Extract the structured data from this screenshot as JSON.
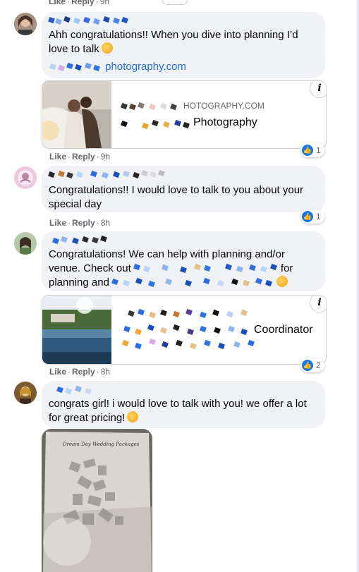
{
  "top": {
    "like": "Like",
    "reply": "Reply",
    "time": "9h"
  },
  "comments": [
    {
      "text_line1": "Ahh congratulations!! When you dive into planning I’d",
      "text_line2": "love to talk",
      "emoji_icon": "smiling-face-with-hearts",
      "link_text": "photography.com",
      "card": {
        "site": "HOTOGRAPHY.COM",
        "title": "Photography",
        "info_icon": "info-icon"
      },
      "actions": {
        "like": "Like",
        "reply": "Reply",
        "time": "9h"
      },
      "reactions": "1"
    },
    {
      "text_line1": "Congratulations!! I would love to talk to you about your",
      "text_line2": "special day",
      "actions": {
        "like": "Like",
        "reply": "Reply",
        "time": "8h"
      },
      "reactions": "1"
    },
    {
      "text_line1": "Congratulations! We can help with planning and/or",
      "text_line2": "venue. Check out",
      "text_line2b": "for",
      "text_line3": "planning and",
      "emoji_icon": "smiling-face",
      "card": {
        "title": "Coordinator",
        "info_icon": "info-icon"
      },
      "actions": {
        "like": "Like",
        "reply": "Reply",
        "time": "8h"
      },
      "reactions": "2"
    },
    {
      "text_line1": "congrats girl! i would love to talk with you! we offer a lot",
      "text_line2": "for great pricing!",
      "emoji_icon": "grinning-face",
      "photo_caption": "Dream Day Wedding Packages"
    }
  ],
  "colors": {
    "bubble": "#f0f2f5",
    "link": "#216fdb",
    "like_blue": "#1877f2",
    "meta_gray": "#65676b"
  }
}
